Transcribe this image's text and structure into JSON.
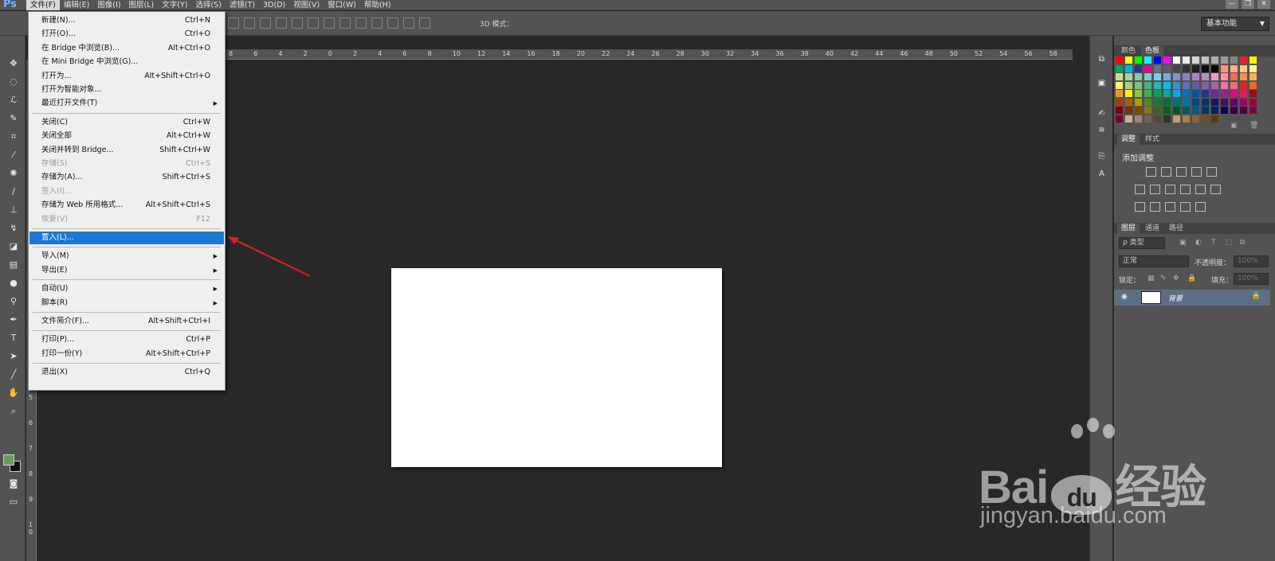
{
  "app": {
    "logo": "Ps"
  },
  "menubar": {
    "items": [
      "文件(F)",
      "编辑(E)",
      "图像(I)",
      "图层(L)",
      "文字(Y)",
      "选择(S)",
      "滤镜(T)",
      "3D(D)",
      "视图(V)",
      "窗口(W)",
      "帮助(H)"
    ],
    "open_index": 0
  },
  "window_controls": [
    "—",
    "❐",
    "✕"
  ],
  "options_bar": {
    "mode_3d": "3D 模式：",
    "workspace": "基本功能"
  },
  "ruler_top": [
    "8",
    "6",
    "4",
    "2",
    "0",
    "2",
    "4",
    "6",
    "8",
    "10",
    "12",
    "14",
    "16",
    "18",
    "20",
    "22",
    "24",
    "26",
    "28",
    "30",
    "32",
    "34",
    "36",
    "38",
    "40",
    "42",
    "44",
    "46",
    "48",
    "50",
    "52",
    "54",
    "56",
    "58"
  ],
  "ruler_left": [
    "5",
    "6",
    "7",
    "8",
    "9",
    "1 0"
  ],
  "file_menu": {
    "items": [
      {
        "label": "新建(N)...",
        "shortcut": "Ctrl+N"
      },
      {
        "label": "打开(O)...",
        "shortcut": "Ctrl+O"
      },
      {
        "label": "在 Bridge 中浏览(B)...",
        "shortcut": "Alt+Ctrl+O"
      },
      {
        "label": "在 Mini Bridge 中浏览(G)...",
        "shortcut": ""
      },
      {
        "label": "打开为...",
        "shortcut": "Alt+Shift+Ctrl+O"
      },
      {
        "label": "打开为智能对象...",
        "shortcut": ""
      },
      {
        "label": "最近打开文件(T)",
        "shortcut": "",
        "submenu": true
      },
      {
        "label": "关闭(C)",
        "shortcut": "Ctrl+W"
      },
      {
        "label": "关闭全部",
        "shortcut": "Alt+Ctrl+W"
      },
      {
        "label": "关闭并转到 Bridge...",
        "shortcut": "Shift+Ctrl+W"
      },
      {
        "label": "存储(S)",
        "shortcut": "Ctrl+S",
        "disabled": true
      },
      {
        "label": "存储为(A)...",
        "shortcut": "Shift+Ctrl+S"
      },
      {
        "label": "签入(I)...",
        "shortcut": "",
        "disabled": true
      },
      {
        "label": "存储为 Web 所用格式...",
        "shortcut": "Alt+Shift+Ctrl+S"
      },
      {
        "label": "恢复(V)",
        "shortcut": "F12",
        "disabled": true
      },
      {
        "label": "置入(L)...",
        "shortcut": "",
        "highlighted": true
      },
      {
        "label": "导入(M)",
        "shortcut": "",
        "submenu": true
      },
      {
        "label": "导出(E)",
        "shortcut": "",
        "submenu": true
      },
      {
        "label": "自动(U)",
        "shortcut": "",
        "submenu": true
      },
      {
        "label": "脚本(R)",
        "shortcut": "",
        "submenu": true
      },
      {
        "label": "文件简介(F)...",
        "shortcut": "Alt+Shift+Ctrl+I"
      },
      {
        "label": "打印(P)...",
        "shortcut": "Ctrl+P"
      },
      {
        "label": "打印一份(Y)",
        "shortcut": "Alt+Shift+Ctrl+P"
      },
      {
        "label": "退出(X)",
        "shortcut": "Ctrl+Q"
      }
    ]
  },
  "panels": {
    "color_tabs": [
      "颜色",
      "色板"
    ],
    "adjust_tabs": [
      "调整",
      "样式"
    ],
    "adjust_title": "添加调整",
    "layer_tabs": [
      "图层",
      "通道",
      "路径"
    ],
    "filter_kind": "ρ 类型",
    "blend_mode": "正常",
    "opacity_label": "不透明度：",
    "opacity_value": "100%",
    "lock_label": "锁定：",
    "fill_label": "填充：",
    "fill_value": "100%",
    "layer_name": "背景"
  },
  "swatch_colors": [
    [
      "#ff0000",
      "#ffff00",
      "#00ff00",
      "#00ffff",
      "#0000ff",
      "#ff00ff",
      "#ffffff",
      "#ebebeb",
      "#d6d6d6",
      "#c2c2c2",
      "#adadad",
      "#999999",
      "#858585",
      "#ed1c24",
      "#fff200"
    ],
    [
      "#00a651",
      "#00aeef",
      "#2e3192",
      "#ec008c",
      "#707070",
      "#5c5c5c",
      "#474747",
      "#333333",
      "#1f1f1f",
      "#0a0a0a",
      "#000000",
      "#f7977a",
      "#f9ad81",
      "#fdc68a",
      "#fff799"
    ],
    [
      "#c4df9b",
      "#a3d39c",
      "#82ca9d",
      "#7bcdc8",
      "#6ecff6",
      "#7ea7d8",
      "#8493ca",
      "#8882be",
      "#a187be",
      "#bc8dbf",
      "#f49ac2",
      "#f6989d",
      "#f26c4f",
      "#f68e56",
      "#fbaf5c"
    ],
    [
      "#fff568",
      "#acd372",
      "#7cc576",
      "#3bb878",
      "#1abbb4",
      "#00bff3",
      "#438ccb",
      "#5574b9",
      "#605ca8",
      "#855fa8",
      "#a763a8",
      "#f06eaa",
      "#f26d7d",
      "#ed1c24",
      "#f26522"
    ],
    [
      "#f7941d",
      "#fff200",
      "#8dc73f",
      "#39b54a",
      "#00a651",
      "#00a99d",
      "#00aeef",
      "#0072bc",
      "#0054a6",
      "#2e3192",
      "#662d91",
      "#92278f",
      "#ec008c",
      "#ed145b",
      "#9e0b0f"
    ],
    [
      "#a0410d",
      "#a36209",
      "#aba000",
      "#598527",
      "#1a7b30",
      "#007236",
      "#00746b",
      "#0076a3",
      "#004b80",
      "#003471",
      "#1b1464",
      "#440e62",
      "#630460",
      "#9e005d",
      "#9e0039"
    ],
    [
      "#790000",
      "#7b2e00",
      "#7d4900",
      "#827b00",
      "#406618",
      "#005e20",
      "#005826",
      "#005952",
      "#005b7f",
      "#003663",
      "#002157",
      "#0d004c",
      "#32004b",
      "#4b0049",
      "#7b0046"
    ],
    [
      "#7a0026",
      "#c7b299",
      "#998675",
      "#736357",
      "#534741",
      "#37302d",
      "#c69c6d",
      "#a67c52",
      "#8c6239",
      "#754c24",
      "#603913"
    ]
  ],
  "watermark": {
    "logo": "Bai🐾 经验",
    "brand_a": "Bai",
    "brand_b": "du",
    "brand_c": "经验",
    "url": "jingyan.baidu.com"
  }
}
